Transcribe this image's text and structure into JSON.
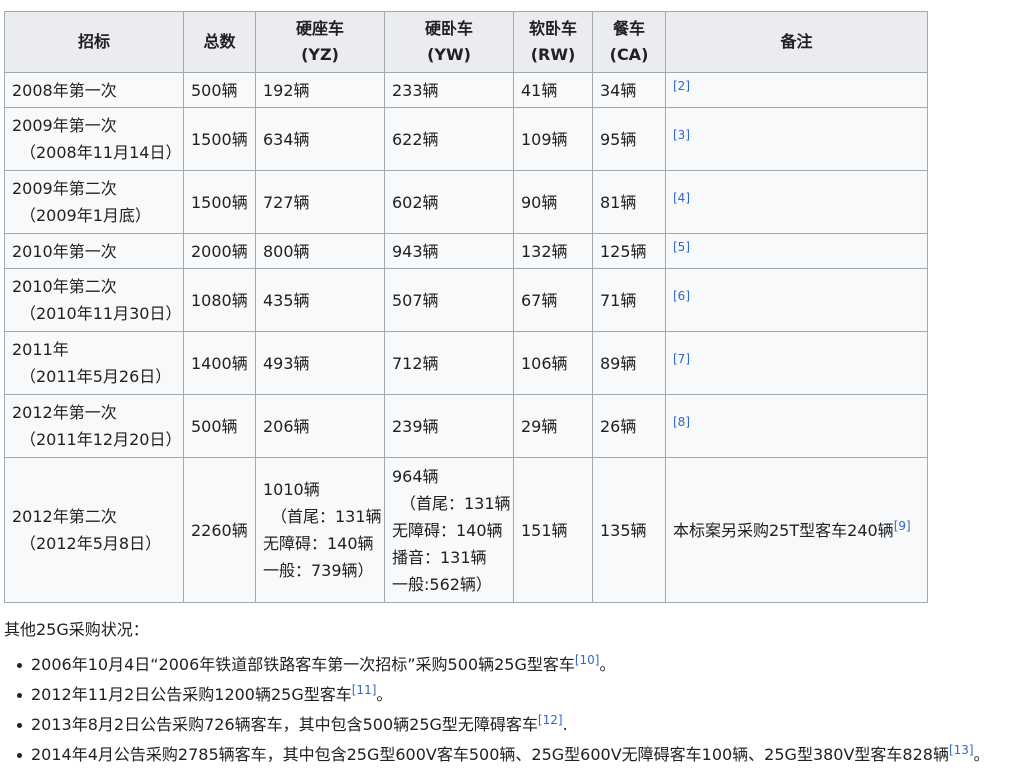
{
  "table": {
    "headers": [
      {
        "line1": "招标",
        "line2": ""
      },
      {
        "line1": "总数",
        "line2": ""
      },
      {
        "line1": "硬座车",
        "line2": "(YZ)"
      },
      {
        "line1": "硬卧车",
        "line2": "(YW)"
      },
      {
        "line1": "软卧车",
        "line2": "(RW)"
      },
      {
        "line1": "餐车",
        "line2": "(CA)"
      },
      {
        "line1": "备注",
        "line2": ""
      }
    ],
    "rows": [
      {
        "bid1": "2008年第一次",
        "bid2": "",
        "total": "500辆",
        "yz": [
          "192辆"
        ],
        "yw": [
          "233辆"
        ],
        "rw": "41辆",
        "ca": "34辆",
        "note": "",
        "ref": "[2]"
      },
      {
        "bid1": "2009年第一次",
        "bid2": "（2008年11月14日）",
        "total": "1500辆",
        "yz": [
          "634辆"
        ],
        "yw": [
          "622辆"
        ],
        "rw": "109辆",
        "ca": "95辆",
        "note": "",
        "ref": "[3]"
      },
      {
        "bid1": "2009年第二次",
        "bid2": "（2009年1月底）",
        "total": "1500辆",
        "yz": [
          "727辆"
        ],
        "yw": [
          "602辆"
        ],
        "rw": "90辆",
        "ca": "81辆",
        "note": "",
        "ref": "[4]"
      },
      {
        "bid1": "2010年第一次",
        "bid2": "",
        "total": "2000辆",
        "yz": [
          "800辆"
        ],
        "yw": [
          "943辆"
        ],
        "rw": "132辆",
        "ca": "125辆",
        "note": "",
        "ref": "[5]"
      },
      {
        "bid1": "2010年第二次",
        "bid2": "（2010年11月30日）",
        "total": "1080辆",
        "yz": [
          "435辆"
        ],
        "yw": [
          "507辆"
        ],
        "rw": "67辆",
        "ca": "71辆",
        "note": "",
        "ref": "[6]"
      },
      {
        "bid1": "2011年",
        "bid2": "（2011年5月26日）",
        "total": "1400辆",
        "yz": [
          "493辆"
        ],
        "yw": [
          "712辆"
        ],
        "rw": "106辆",
        "ca": "89辆",
        "note": "",
        "ref": "[7]"
      },
      {
        "bid1": "2012年第一次",
        "bid2": "（2011年12月20日）",
        "total": "500辆",
        "yz": [
          "206辆"
        ],
        "yw": [
          "239辆"
        ],
        "rw": "29辆",
        "ca": "26辆",
        "note": "",
        "ref": "[8]"
      },
      {
        "bid1": "2012年第二次",
        "bid2": "（2012年5月8日）",
        "total": "2260辆",
        "yz": [
          "1010辆",
          "（首尾：131辆",
          "无障碍：140辆",
          "一般：739辆）"
        ],
        "yw": [
          "964辆",
          "（首尾：131辆",
          "无障碍：140辆",
          "播音：131辆",
          "一般:562辆）"
        ],
        "rw": "151辆",
        "ca": "135辆",
        "note": "本标案另采购25T型客车240辆",
        "ref": "[9]"
      }
    ]
  },
  "other": {
    "heading": "其他25G采购状况：",
    "items": [
      {
        "text": "2006年10月4日“2006年铁道部铁路客车第一次招标”采购500辆25G型客车",
        "ref": "[10]",
        "tail": "。"
      },
      {
        "text": "2012年11月2日公告采购1200辆25G型客车",
        "ref": "[11]",
        "tail": "。"
      },
      {
        "text": "2013年8月2日公告采购726辆客车，其中包含500辆25G型无障碍客车",
        "ref": "[12]",
        "tail": "."
      },
      {
        "text": "2014年4月公告采购2785辆客车，其中包含25G型600V客车500辆、25G型600V无障碍客车100辆、25G型380V型客车828辆",
        "ref": "[13]",
        "tail": "。"
      }
    ]
  },
  "colors": {
    "link": "#3366cc",
    "header_bg": "#eaecf0",
    "cell_bg": "#f8f9fa",
    "border": "#a2a9b1",
    "text": "#202122"
  }
}
